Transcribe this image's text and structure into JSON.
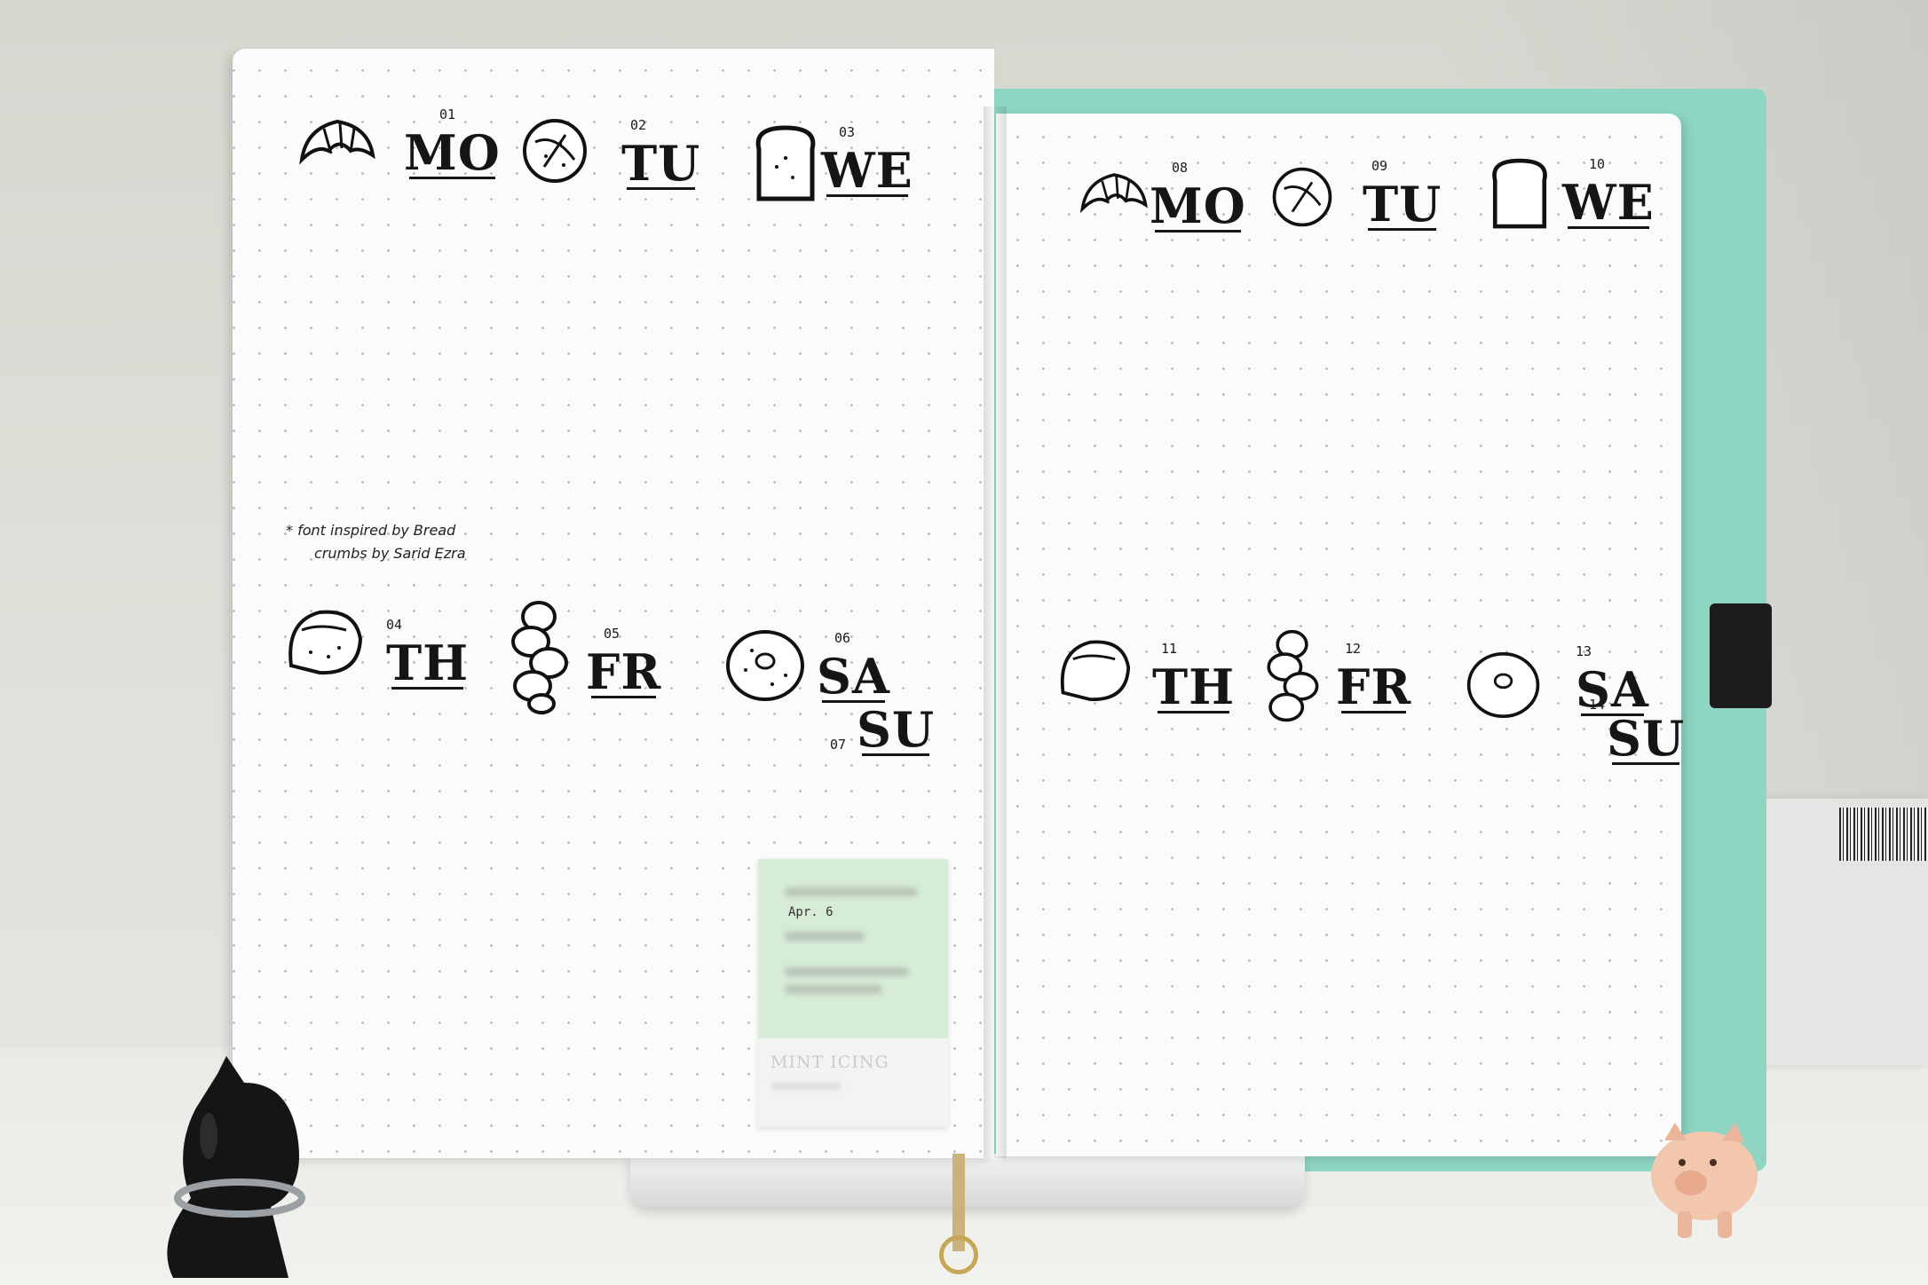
{
  "left_page": {
    "week_top": [
      {
        "num": "01",
        "day": "MO",
        "icon": "croissant-icon"
      },
      {
        "num": "02",
        "day": "TU",
        "icon": "sourdough-icon"
      },
      {
        "num": "03",
        "day": "WE",
        "icon": "toast-icon"
      }
    ],
    "week_bottom": [
      {
        "num": "04",
        "day": "TH",
        "icon": "baguette-icon"
      },
      {
        "num": "05",
        "day": "FR",
        "icon": "challah-icon"
      },
      {
        "num": "06",
        "day": "SA",
        "icon": "bagel-icon"
      },
      {
        "num": "07",
        "day": "SU"
      }
    ],
    "note_line1": "* font inspired by Bread",
    "note_line2": "crumbs by Sarid Ezra"
  },
  "right_page": {
    "week_top": [
      {
        "num": "08",
        "day": "MO",
        "icon": "croissant-icon"
      },
      {
        "num": "09",
        "day": "TU",
        "icon": "sourdough-icon"
      },
      {
        "num": "10",
        "day": "WE",
        "icon": "toast-icon"
      }
    ],
    "week_bottom": [
      {
        "num": "11",
        "day": "TH",
        "icon": "baguette-icon"
      },
      {
        "num": "12",
        "day": "FR",
        "icon": "challah-icon"
      },
      {
        "num": "13",
        "day": "SA",
        "icon": "bagel-icon"
      },
      {
        "num": "14",
        "day": "SU"
      }
    ]
  },
  "swatch_card": {
    "date": "Apr. 6",
    "title": "MINT ICING",
    "color": "#d6ecd6"
  },
  "colors": {
    "cover": "#8ed6c2",
    "paper": "#fbfbfc",
    "ink": "#151515"
  }
}
